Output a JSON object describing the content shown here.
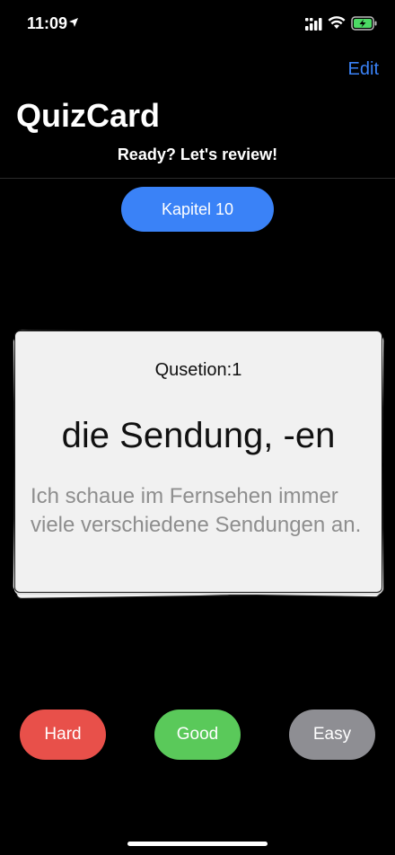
{
  "status_bar": {
    "time": "11:09",
    "icons": [
      "location-arrow-icon",
      "signal-icon",
      "wifi-icon",
      "battery-charging-icon"
    ]
  },
  "nav": {
    "edit_label": "Edit",
    "title": "QuizCard",
    "subtitle": "Ready? Let's review!"
  },
  "chapter": {
    "label": "Kapitel 10"
  },
  "card": {
    "number_label": "Qusetion:1",
    "term": "die Sendung, -en",
    "example": "Ich schaue im Fernsehen immer viele verschiedene Sendungen an."
  },
  "answers": {
    "hard_label": "Hard",
    "good_label": "Good",
    "easy_label": "Easy"
  },
  "colors": {
    "accent": "#3a82f7",
    "hard": "#e8504a",
    "good": "#5ac95a",
    "easy": "#8e8e93",
    "card_bg": "#f1f1f1",
    "example_text": "#8e8e8e"
  }
}
